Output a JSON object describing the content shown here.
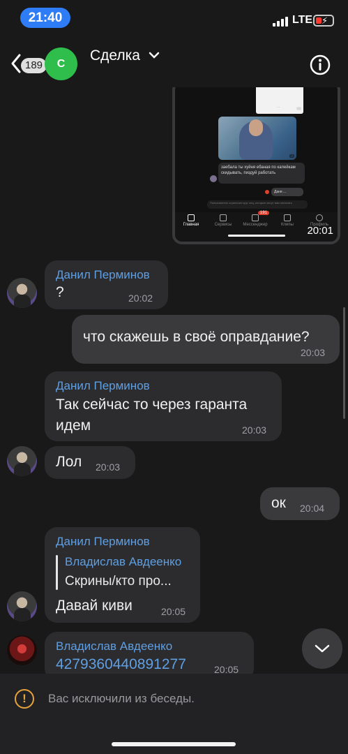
{
  "status_bar": {
    "time": "21:40",
    "network": "LTE"
  },
  "header": {
    "back_badge": "189",
    "avatar_letter": "С",
    "title": "Сделка"
  },
  "screenshot_preview": {
    "mini_message": "заебала ты хуйня ебаная по капейкам скидывать, пиздуй работать",
    "mini_outgoing": "Даня ...",
    "mini_warning": "Пользователь ограничил круг лиц, которые могут вам написать",
    "tabs": [
      {
        "label": "Главная"
      },
      {
        "label": "Сервисы"
      },
      {
        "label": "Мессенджер"
      },
      {
        "label": "Клипы"
      },
      {
        "label": "Профиль"
      }
    ],
    "messenger_badge": "191",
    "time": "20:01"
  },
  "messages": [
    {
      "sender": "Данил Перминов",
      "text": "?",
      "time": "20:02"
    },
    {
      "text": "что скажешь в своё оправдание?",
      "time": "20:03"
    },
    {
      "sender": "Данил Перминов",
      "text_line1": "Так сейчас то через гаранта",
      "text_line2": "идем",
      "time": "20:03"
    },
    {
      "text": "Лол",
      "time": "20:03"
    },
    {
      "text": "ок",
      "time": "20:04"
    },
    {
      "sender": "Данил Перминов",
      "quote_name": "Владислав Авдеенко",
      "quote_text": "Скрины/кто про...",
      "text": "Давай киви",
      "time": "20:05"
    },
    {
      "sender": "Владислав Авдеенко",
      "text": "4279360440891277",
      "time": "20:05"
    }
  ],
  "footer": {
    "notice": "Вас исключили из беседы."
  },
  "colors": {
    "accent": "#5f9fe2",
    "background": "#19191a",
    "bubble_in": "#2c2c2e",
    "bubble_out": "#3a3a3c",
    "warning": "#e6a23c"
  }
}
